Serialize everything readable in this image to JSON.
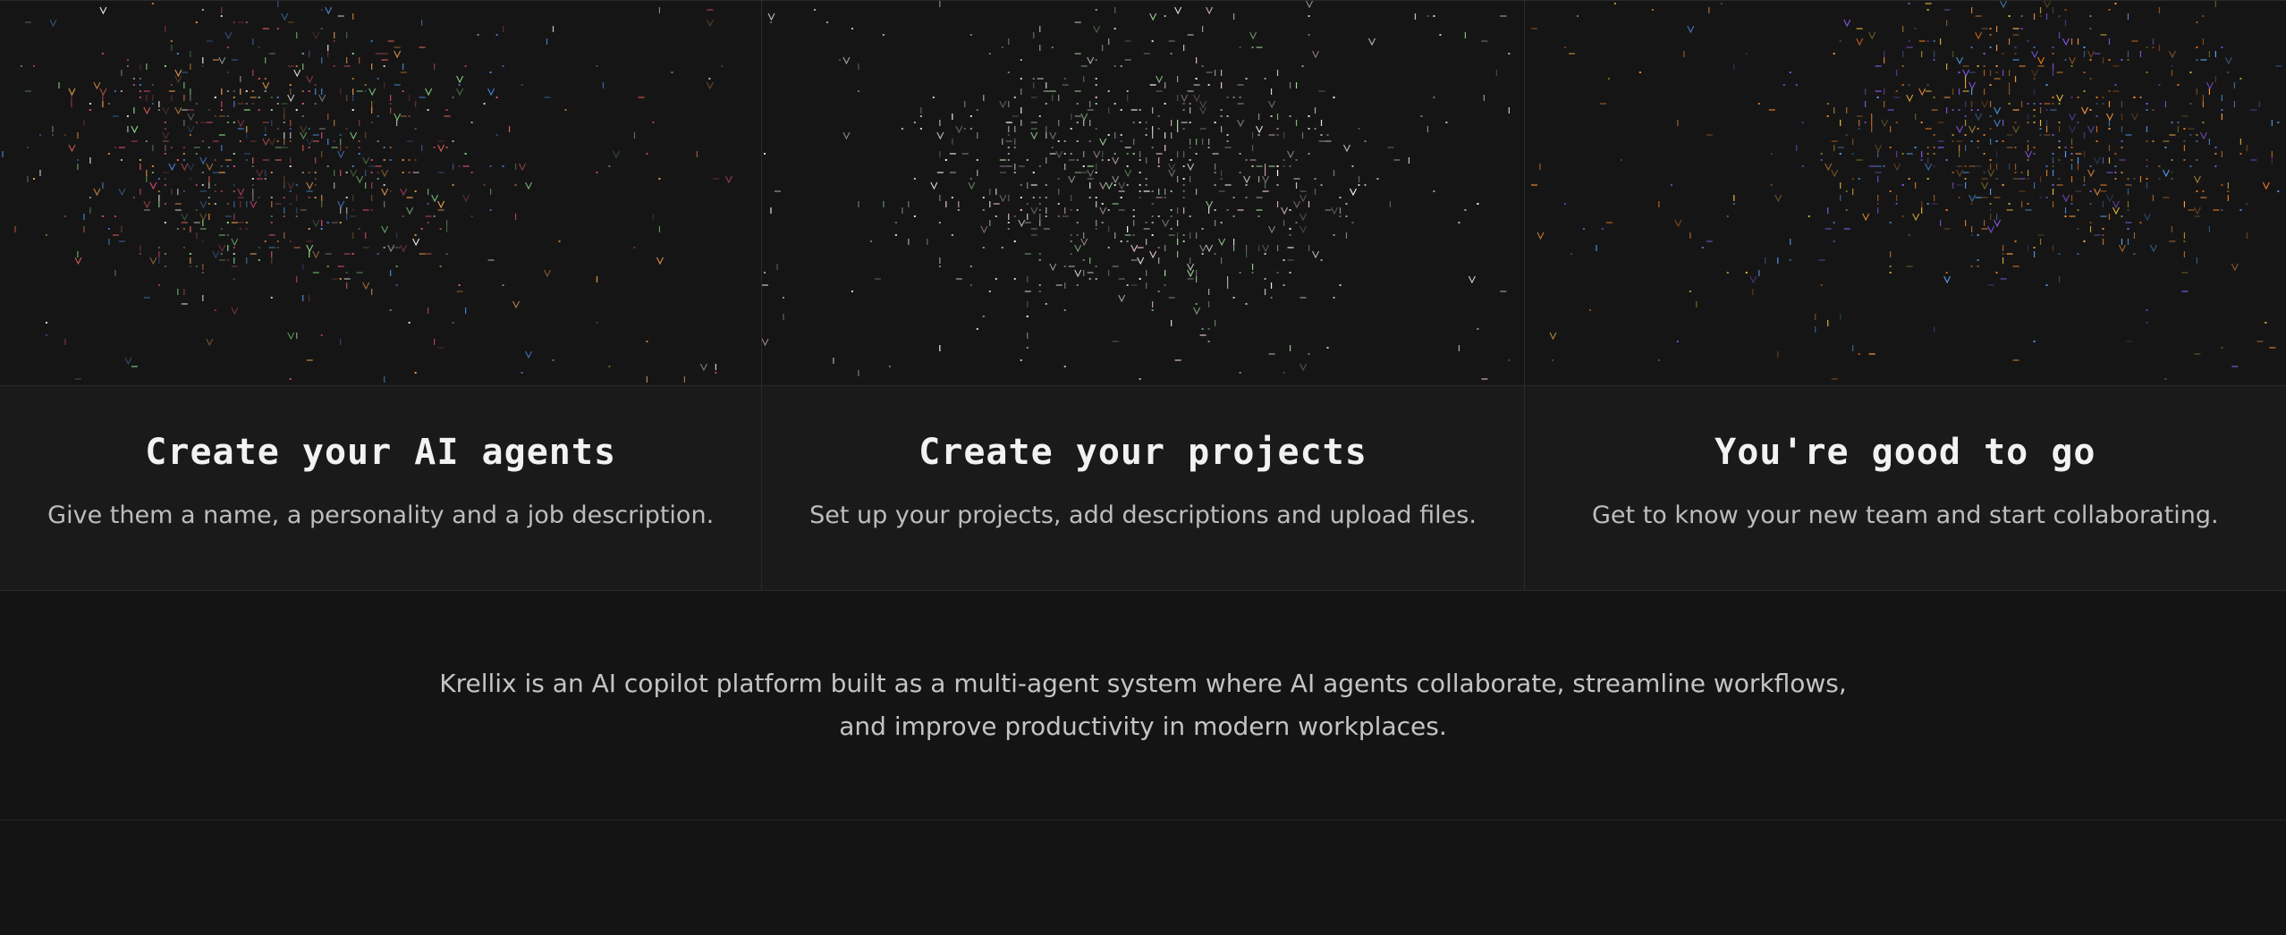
{
  "steps": [
    {
      "title": "Create your AI agents",
      "description": "Give them a name, a personality and a job description.",
      "art_icon": "ascii-art-pattern-icon",
      "palette": [
        "#e0635a",
        "#8ee08a",
        "#4a86d8",
        "#d94a7a",
        "#f0a050",
        "#f0f0f0"
      ]
    },
    {
      "title": "Create your projects",
      "description": "Set up your projects, add descriptions and upload files.",
      "art_icon": "ascii-art-pattern-icon",
      "palette": [
        "#d8d8d8",
        "#a8e0a0",
        "#f0c8d0",
        "#ffffff"
      ]
    },
    {
      "title": "You're good to go",
      "description": "Get to know your new team and start collaborating.",
      "art_icon": "ascii-art-pattern-icon",
      "palette": [
        "#f07a20",
        "#8a5cf0",
        "#f0c040",
        "#5aa0f0",
        "#ff9a40"
      ]
    }
  ],
  "about": {
    "text": "Krellix is an AI copilot platform built as a multi-agent system where AI agents collaborate, streamline workflows, and improve productivity in modern workplaces."
  },
  "colors": {
    "background": "#141414",
    "card": "#1a1a1a",
    "border": "#2a2a2a"
  }
}
